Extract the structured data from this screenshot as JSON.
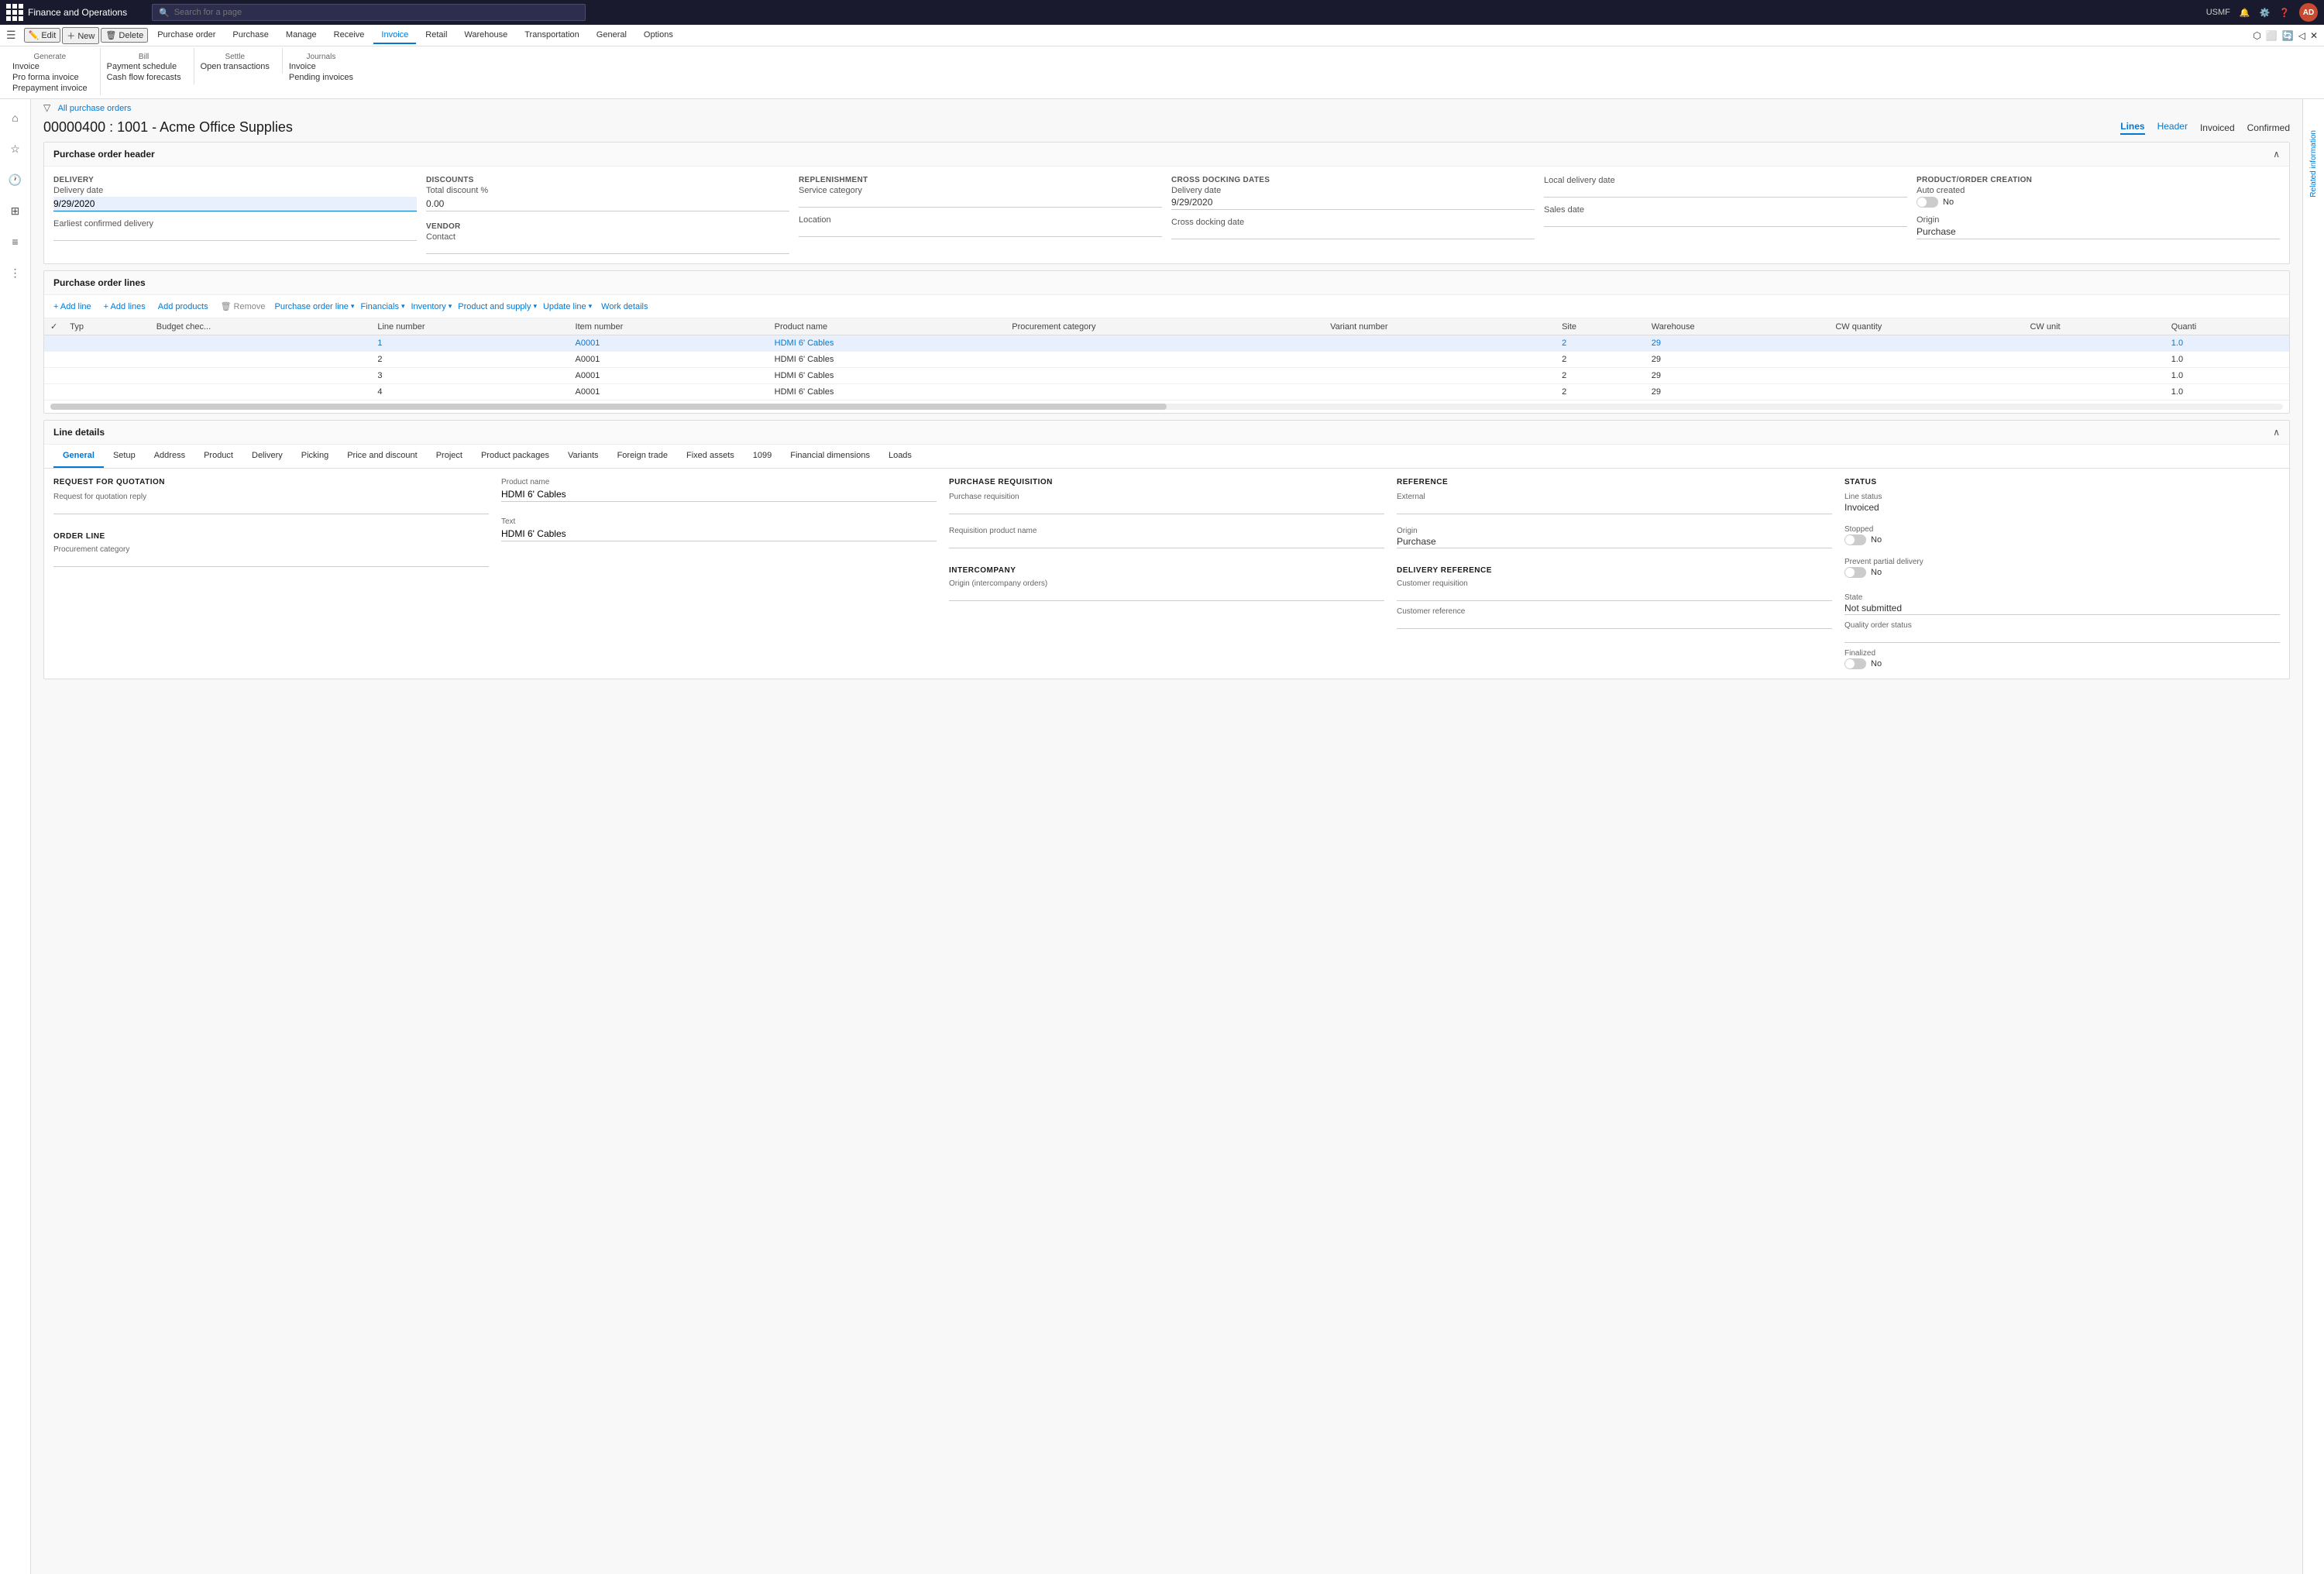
{
  "app": {
    "title": "Finance and Operations",
    "user": "USMF",
    "avatar": "AD"
  },
  "search": {
    "placeholder": "Search for a page"
  },
  "ribbon_tabs": [
    {
      "id": "purchase-order",
      "label": "Purchase order"
    },
    {
      "id": "purchase",
      "label": "Purchase"
    },
    {
      "id": "manage",
      "label": "Manage"
    },
    {
      "id": "receive",
      "label": "Receive"
    },
    {
      "id": "invoice",
      "label": "Invoice",
      "active": true
    },
    {
      "id": "retail",
      "label": "Retail"
    },
    {
      "id": "warehouse",
      "label": "Warehouse"
    },
    {
      "id": "transportation",
      "label": "Transportation"
    },
    {
      "id": "general",
      "label": "General"
    },
    {
      "id": "options",
      "label": "Options"
    }
  ],
  "ribbon_actions": {
    "edit": "Edit",
    "new": "New",
    "delete": "Delete",
    "generate_title": "Generate",
    "invoice": "Invoice",
    "pro_forma_invoice": "Pro forma invoice",
    "prepayment_invoice": "Prepayment invoice",
    "bill_title": "Bill",
    "payment_schedule": "Payment schedule",
    "cash_flow_forecasts": "Cash flow forecasts",
    "settle_title": "Settle",
    "open_transactions": "Open transactions",
    "journals_title": "Journals",
    "journal_invoice": "Invoice",
    "pending_invoices": "Pending invoices"
  },
  "breadcrumb": "All purchase orders",
  "page_title": "00000400 : 1001 - Acme Office Supplies",
  "view_tabs": [
    "Lines",
    "Header"
  ],
  "active_view_tab": "Lines",
  "status": {
    "invoiced": "Invoiced",
    "confirmed": "Confirmed"
  },
  "purchase_order_header": {
    "title": "Purchase order header",
    "delivery": {
      "label": "DELIVERY",
      "delivery_date_label": "Delivery date",
      "delivery_date_value": "9/29/2020",
      "earliest_label": "Earliest confirmed delivery"
    },
    "discounts": {
      "label": "DISCOUNTS",
      "total_discount_label": "Total discount %",
      "total_discount_value": "0.00"
    },
    "replenishment": {
      "label": "REPLENISHMENT",
      "service_category_label": "Service category",
      "location_label": "Location"
    },
    "cross_docking": {
      "label": "CROSS DOCKING DATES",
      "delivery_date_label": "Delivery date",
      "delivery_date_value": "9/29/2020",
      "cross_docking_date_label": "Cross docking date"
    },
    "local_delivery": {
      "label": "Local delivery date",
      "sales_date_label": "Sales date"
    },
    "vendor": {
      "label": "VENDOR",
      "contact_label": "Contact"
    },
    "product_order_creation": {
      "label": "PRODUCT/ORDER CREATION",
      "auto_created_label": "Auto created",
      "auto_created_toggle": false,
      "auto_created_value": "No",
      "origin_label": "Origin",
      "origin_value": "Purchase"
    }
  },
  "purchase_order_lines": {
    "title": "Purchase order lines",
    "toolbar": {
      "add_line": "+ Add line",
      "add_lines": "+ Add lines",
      "add_products": "Add products",
      "remove": "Remove",
      "purchase_order_line": "Purchase order line",
      "financials": "Financials",
      "inventory": "Inventory",
      "product_and_supply": "Product and supply",
      "update_line": "Update line",
      "work_details": "Work details"
    },
    "columns": [
      "",
      "Typ",
      "Budget chec...",
      "Line number",
      "Item number",
      "Product name",
      "Procurement category",
      "Variant number",
      "Site",
      "Warehouse",
      "CW quantity",
      "CW unit",
      "Quanti"
    ],
    "rows": [
      {
        "selected": true,
        "typ": "",
        "budget": "",
        "line": 1,
        "item": "A0001",
        "product": "HDMI 6' Cables",
        "proc_cat": "",
        "variant": "",
        "site": "2",
        "warehouse": "29",
        "cw_qty": "",
        "cw_unit": "",
        "qty": "1.0"
      },
      {
        "selected": false,
        "typ": "",
        "budget": "",
        "line": 2,
        "item": "A0001",
        "product": "HDMI 6' Cables",
        "proc_cat": "",
        "variant": "",
        "site": "2",
        "warehouse": "29",
        "cw_qty": "",
        "cw_unit": "",
        "qty": "1.0"
      },
      {
        "selected": false,
        "typ": "",
        "budget": "",
        "line": 3,
        "item": "A0001",
        "product": "HDMI 6' Cables",
        "proc_cat": "",
        "variant": "",
        "site": "2",
        "warehouse": "29",
        "cw_qty": "",
        "cw_unit": "",
        "qty": "1.0"
      },
      {
        "selected": false,
        "typ": "",
        "budget": "",
        "line": 4,
        "item": "A0001",
        "product": "HDMI 6' Cables",
        "proc_cat": "",
        "variant": "",
        "site": "2",
        "warehouse": "29",
        "cw_qty": "",
        "cw_unit": "",
        "qty": "1.0"
      }
    ]
  },
  "line_details": {
    "title": "Line details",
    "tabs": [
      "General",
      "Setup",
      "Address",
      "Product",
      "Delivery",
      "Picking",
      "Price and discount",
      "Project",
      "Product packages",
      "Variants",
      "Foreign trade",
      "Fixed assets",
      "1099",
      "Financial dimensions",
      "Loads"
    ],
    "active_tab": "General",
    "request_for_quotation": {
      "title": "REQUEST FOR QUOTATION",
      "label": "Request for quotation reply"
    },
    "order_line": {
      "title": "ORDER LINE",
      "proc_category_label": "Procurement category"
    },
    "product_name_label": "Product name",
    "product_name_value": "HDMI 6' Cables",
    "text_label": "Text",
    "text_value": "HDMI 6' Cables",
    "purchase_requisition": {
      "title": "PURCHASE REQUISITION",
      "label": "Purchase requisition",
      "req_product_name_label": "Requisition product name"
    },
    "intercompany": {
      "title": "INTERCOMPANY",
      "label": "Origin (intercompany orders)"
    },
    "reference": {
      "title": "REFERENCE",
      "external_label": "External",
      "origin_label": "Origin",
      "origin_value": "Purchase"
    },
    "delivery_reference": {
      "title": "DELIVERY REFERENCE",
      "customer_requisition_label": "Customer requisition",
      "customer_reference_label": "Customer reference"
    },
    "status": {
      "title": "STATUS",
      "line_status_label": "Line status",
      "line_status_value": "Invoiced",
      "stopped_label": "Stopped",
      "stopped_toggle": false,
      "stopped_value": "No",
      "prevent_partial_label": "Prevent partial delivery",
      "prevent_partial_toggle": false,
      "prevent_partial_value": "No"
    },
    "state": {
      "state_label": "State",
      "state_value": "Not submitted",
      "quality_order_label": "Quality order status",
      "finalized_label": "Finalized",
      "finalized_toggle": false,
      "finalized_value": "No"
    }
  },
  "right_panel": {
    "label": "Related information"
  },
  "sidebar_icons": [
    "home",
    "star",
    "clock",
    "table",
    "list",
    "menu"
  ]
}
